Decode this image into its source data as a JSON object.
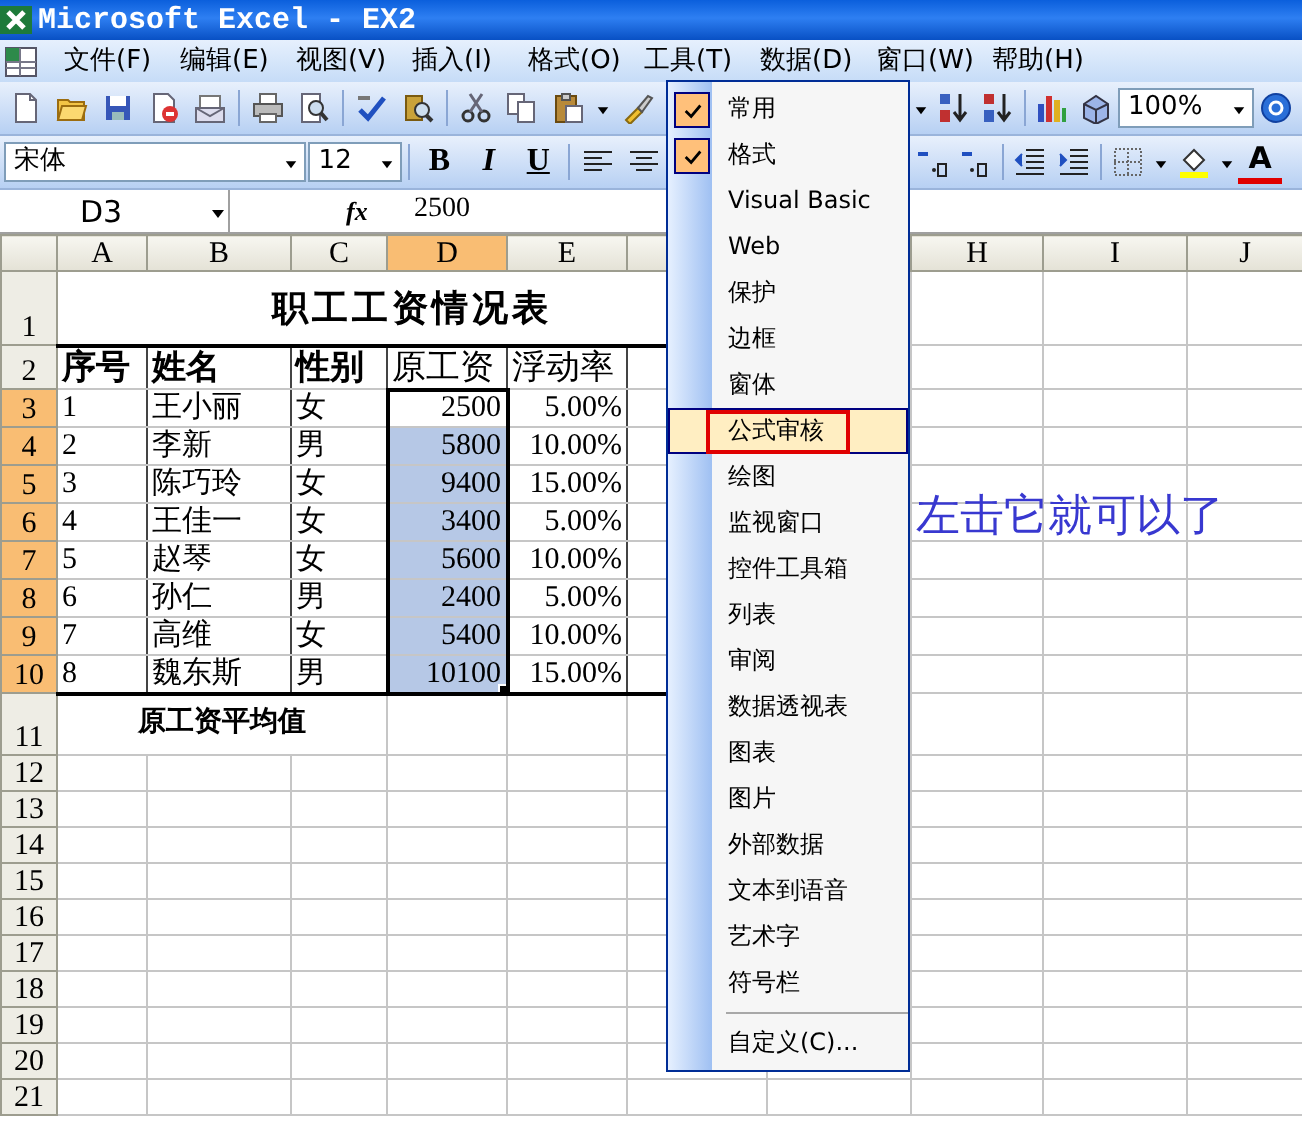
{
  "window": {
    "title": "Microsoft Excel - EX2"
  },
  "menu_bar": [
    "文件(F)",
    "编辑(E)",
    "视图(V)",
    "插入(I)",
    "格式(O)",
    "工具(T)",
    "数据(D)",
    "窗口(W)",
    "帮助(H)"
  ],
  "standard_toolbar": {
    "zoom": "100%"
  },
  "formatting_toolbar": {
    "font": "宋体",
    "size": "12",
    "style_buttons": [
      "B",
      "I",
      "U"
    ],
    "font_color_button": "A"
  },
  "formula_bar": {
    "name_box": "D3",
    "fx": "fx",
    "formula": "2500"
  },
  "sheet": {
    "columns": [
      {
        "label": "A",
        "selected": false
      },
      {
        "label": "B",
        "selected": false
      },
      {
        "label": "C",
        "selected": false
      },
      {
        "label": "D",
        "selected": true
      },
      {
        "label": "E",
        "selected": false
      },
      {
        "label": "H",
        "selected": false
      },
      {
        "label": "I",
        "selected": false
      },
      {
        "label": "J",
        "selected": false
      }
    ],
    "rows": [
      {
        "header": "1",
        "kind": "title",
        "selected": false,
        "text": "职工工资情况表"
      },
      {
        "header": "2",
        "kind": "header",
        "selected": false,
        "cells": [
          {
            "text": "序号",
            "bold": true
          },
          {
            "text": "姓名",
            "bold": true
          },
          {
            "text": "性别",
            "bold": true
          },
          {
            "text": "原工资",
            "bold": false
          },
          {
            "text": "浮动率",
            "bold": false
          }
        ]
      },
      {
        "header": "3",
        "kind": "data",
        "selected": true,
        "active": true,
        "cells": [
          "1",
          "王小丽",
          "女",
          "2500",
          "5.00%"
        ]
      },
      {
        "header": "4",
        "kind": "data",
        "selected": true,
        "active": false,
        "cells": [
          "2",
          "李新",
          "男",
          "5800",
          "10.00%"
        ]
      },
      {
        "header": "5",
        "kind": "data",
        "selected": true,
        "active": false,
        "cells": [
          "3",
          "陈巧玲",
          "女",
          "9400",
          "15.00%"
        ]
      },
      {
        "header": "6",
        "kind": "data",
        "selected": true,
        "active": false,
        "cells": [
          "4",
          "王佳一",
          "女",
          "3400",
          "5.00%"
        ]
      },
      {
        "header": "7",
        "kind": "data",
        "selected": true,
        "active": false,
        "cells": [
          "5",
          "赵琴",
          "女",
          "5600",
          "10.00%"
        ]
      },
      {
        "header": "8",
        "kind": "data",
        "selected": true,
        "active": false,
        "cells": [
          "6",
          "孙仁",
          "男",
          "2400",
          "5.00%"
        ]
      },
      {
        "header": "9",
        "kind": "data",
        "selected": true,
        "active": false,
        "cells": [
          "7",
          "高维",
          "女",
          "5400",
          "10.00%"
        ]
      },
      {
        "header": "10",
        "kind": "data",
        "selected": true,
        "active": false,
        "cells": [
          "8",
          "魏东斯",
          "男",
          "10100",
          "15.00%"
        ]
      },
      {
        "header": "11",
        "kind": "label",
        "selected": false,
        "text": "原工资平均值"
      },
      {
        "header": "12",
        "kind": "empty",
        "selected": false
      },
      {
        "header": "13",
        "kind": "empty",
        "selected": false
      },
      {
        "header": "14",
        "kind": "empty",
        "selected": false
      },
      {
        "header": "15",
        "kind": "empty",
        "selected": false
      },
      {
        "header": "16",
        "kind": "empty",
        "selected": false
      },
      {
        "header": "17",
        "kind": "empty",
        "selected": false
      },
      {
        "header": "18",
        "kind": "empty",
        "selected": false
      },
      {
        "header": "19",
        "kind": "empty",
        "selected": false
      },
      {
        "header": "20",
        "kind": "empty",
        "selected": false
      },
      {
        "header": "21",
        "kind": "empty",
        "selected": false
      }
    ]
  },
  "toolbars_menu": [
    {
      "kind": "item",
      "label": "常用",
      "checked": true,
      "selected": false,
      "boxed": false
    },
    {
      "kind": "item",
      "label": "格式",
      "checked": true,
      "selected": false,
      "boxed": false
    },
    {
      "kind": "item",
      "label": "Visual Basic",
      "checked": false,
      "selected": false,
      "boxed": false
    },
    {
      "kind": "item",
      "label": "Web",
      "checked": false,
      "selected": false,
      "boxed": false
    },
    {
      "kind": "item",
      "label": "保护",
      "checked": false,
      "selected": false,
      "boxed": false
    },
    {
      "kind": "item",
      "label": "边框",
      "checked": false,
      "selected": false,
      "boxed": false
    },
    {
      "kind": "item",
      "label": "窗体",
      "checked": false,
      "selected": false,
      "boxed": false
    },
    {
      "kind": "item",
      "label": "公式审核",
      "checked": false,
      "selected": true,
      "boxed": true
    },
    {
      "kind": "item",
      "label": "绘图",
      "checked": false,
      "selected": false,
      "boxed": false
    },
    {
      "kind": "item",
      "label": "监视窗口",
      "checked": false,
      "selected": false,
      "boxed": false
    },
    {
      "kind": "item",
      "label": "控件工具箱",
      "checked": false,
      "selected": false,
      "boxed": false
    },
    {
      "kind": "item",
      "label": "列表",
      "checked": false,
      "selected": false,
      "boxed": false
    },
    {
      "kind": "item",
      "label": "审阅",
      "checked": false,
      "selected": false,
      "boxed": false
    },
    {
      "kind": "item",
      "label": "数据透视表",
      "checked": false,
      "selected": false,
      "boxed": false
    },
    {
      "kind": "item",
      "label": "图表",
      "checked": false,
      "selected": false,
      "boxed": false
    },
    {
      "kind": "item",
      "label": "图片",
      "checked": false,
      "selected": false,
      "boxed": false
    },
    {
      "kind": "item",
      "label": "外部数据",
      "checked": false,
      "selected": false,
      "boxed": false
    },
    {
      "kind": "item",
      "label": "文本到语音",
      "checked": false,
      "selected": false,
      "boxed": false
    },
    {
      "kind": "item",
      "label": "艺术字",
      "checked": false,
      "selected": false,
      "boxed": false
    },
    {
      "kind": "item",
      "label": "符号栏",
      "checked": false,
      "selected": false,
      "boxed": false
    },
    {
      "kind": "separator"
    },
    {
      "kind": "item",
      "label": "自定义(C)...",
      "checked": false,
      "selected": false,
      "boxed": false
    }
  ],
  "annotation": {
    "text": "左击它就可以了"
  }
}
